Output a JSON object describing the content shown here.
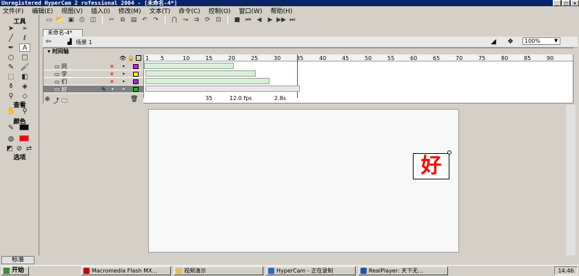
{
  "title": "Unregistered HyperCam 2 rofessional 2004 - [未命名-4*]",
  "menu": [
    "文件(F)",
    "编辑(E)",
    "视图(V)",
    "插入(I)",
    "修改(M)",
    "文本(T)",
    "命令(C)",
    "控制(O)",
    "窗口(W)",
    "帮助(H)"
  ],
  "tools": {
    "title": "工具",
    "view_title": "查看",
    "colors_title": "颜色",
    "options_title": "选项"
  },
  "doc": {
    "tab": "未命名-4*",
    "scene": "场景 1",
    "zoom": "100%"
  },
  "timeline": {
    "label": "时间轴",
    "ruler": [
      "1",
      "5",
      "10",
      "15",
      "20",
      "25",
      "30",
      "35",
      "40",
      "45",
      "50",
      "55",
      "60",
      "65",
      "70",
      "75",
      "80",
      "85",
      "90"
    ],
    "layers": [
      {
        "name": "同",
        "color": "#ff00ff"
      },
      {
        "name": "学",
        "color": "#ffff00"
      },
      {
        "name": "们",
        "color": "#9933cc"
      },
      {
        "name": "好",
        "color": "#00cc00"
      }
    ],
    "frame": "35",
    "fps": "12.0 fps",
    "time": "2.8s"
  },
  "stage": {
    "char": "好"
  },
  "status": {
    "item": "标准"
  },
  "taskbar": {
    "start": "开始",
    "tasks": [
      "Macromedia Flash MX...",
      "视频演示",
      "HyperCam - 正在录制",
      "RealPlayer: 天下无..."
    ],
    "clock": "14:46"
  }
}
